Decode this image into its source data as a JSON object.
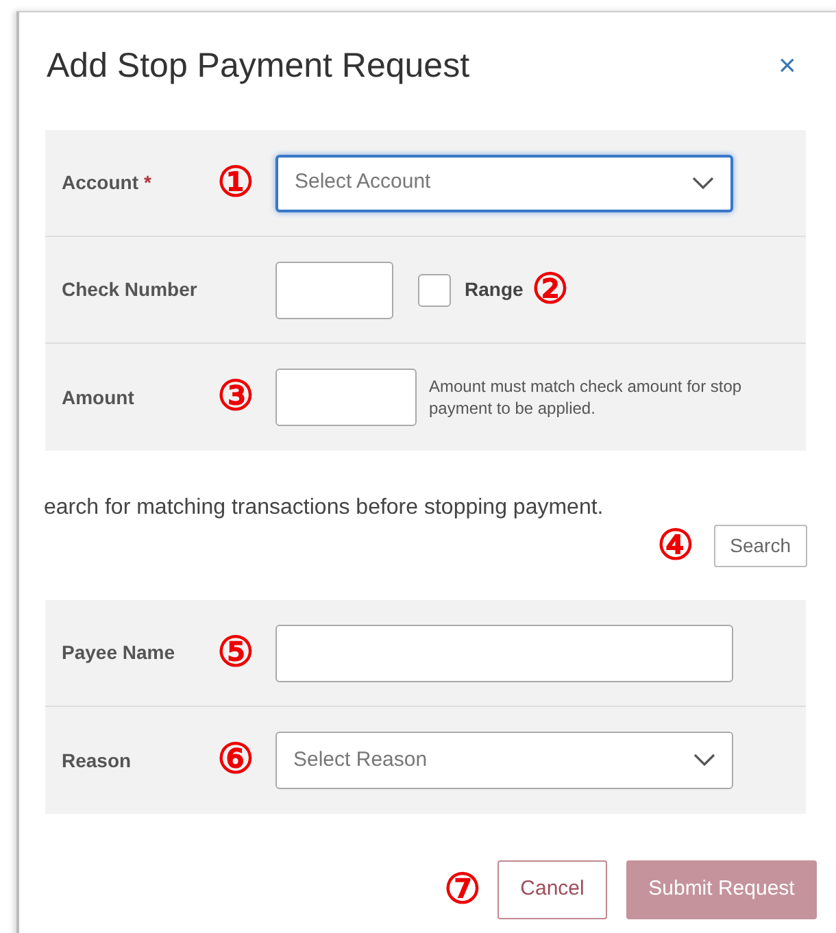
{
  "dialog": {
    "title": "Add Stop Payment Request",
    "close": "×"
  },
  "top_fields": [
    {
      "kind": "select",
      "label": "Account",
      "required_mark": "*",
      "marker": "①",
      "placeholder": "Select Account",
      "focused": true
    },
    {
      "kind": "check",
      "label": "Check Number",
      "marker": "②",
      "checkbox": {
        "label": "Range",
        "checked": false
      }
    },
    {
      "kind": "amount",
      "label": "Amount",
      "marker": "③",
      "help": "Amount must match check amount for stop payment to be applied."
    }
  ],
  "search": {
    "text": "earch for matching transactions before stopping payment.",
    "button": "Search",
    "marker": "④"
  },
  "bottom_fields": [
    {
      "kind": "text",
      "label": "Payee Name",
      "marker": "⑤"
    },
    {
      "kind": "select",
      "label": "Reason",
      "marker": "⑥",
      "placeholder": "Select Reason",
      "focused": false
    }
  ],
  "footer": {
    "marker": "⑦",
    "buttons": [
      {
        "kind": "outline",
        "label": "Cancel",
        "disabled": false
      },
      {
        "kind": "primary",
        "label": "Submit Request",
        "disabled": true
      }
    ]
  }
}
